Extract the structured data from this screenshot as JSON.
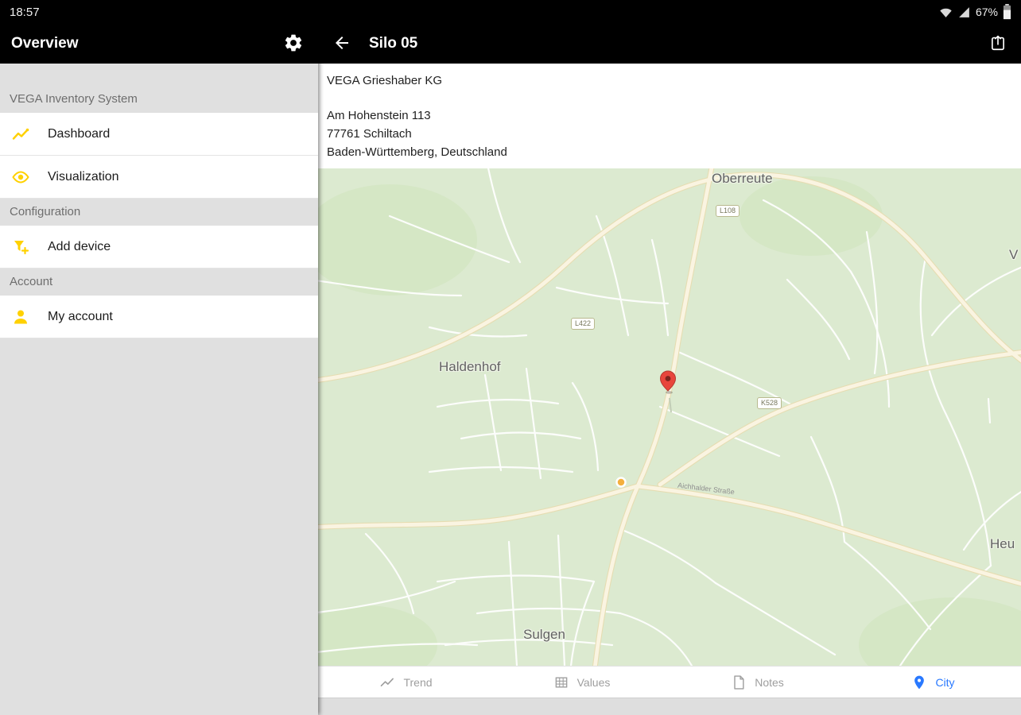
{
  "status_bar": {
    "time": "18:57",
    "battery_percent": "67%"
  },
  "left_panel": {
    "title": "Overview",
    "sections": [
      {
        "label": "VEGA Inventory System",
        "items": [
          {
            "label": "Dashboard",
            "icon": "chart-line-icon"
          },
          {
            "label": "Visualization",
            "icon": "eye-icon"
          }
        ]
      },
      {
        "label": "Configuration",
        "items": [
          {
            "label": "Add device",
            "icon": "add-device-icon"
          }
        ]
      },
      {
        "label": "Account",
        "items": [
          {
            "label": "My account",
            "icon": "person-icon"
          }
        ]
      }
    ]
  },
  "detail_panel": {
    "title": "Silo 05",
    "company": "VEGA Grieshaber KG",
    "address": [
      "Am Hohenstein 113",
      "77761 Schiltach",
      "Baden-Württemberg, Deutschland"
    ],
    "tabs": [
      {
        "label": "Trend",
        "icon": "trend-icon",
        "active": false
      },
      {
        "label": "Values",
        "icon": "values-grid-icon",
        "active": false
      },
      {
        "label": "Notes",
        "icon": "notes-icon",
        "active": false
      },
      {
        "label": "City",
        "icon": "map-pin-icon",
        "active": true
      }
    ]
  },
  "map": {
    "places": [
      {
        "text": "Oberreute"
      },
      {
        "text": "Haldenhof"
      },
      {
        "text": "Sulgen"
      },
      {
        "text": "Heu"
      },
      {
        "text": "V"
      }
    ],
    "road_badges": [
      {
        "text": "L108"
      },
      {
        "text": "L422"
      },
      {
        "text": "K528"
      }
    ],
    "street_label": "Aichhalder Straße"
  },
  "colors": {
    "accent_yellow": "#ffd100",
    "active_tab_blue": "#2979ff",
    "pin_red": "#e8453c",
    "marker_yellow": "#f4af3d",
    "map_background": "#dcead0"
  }
}
